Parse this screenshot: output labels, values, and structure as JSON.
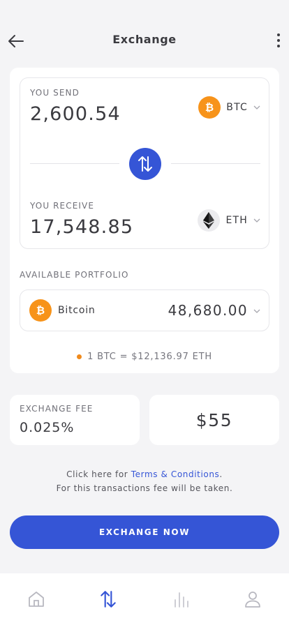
{
  "header": {
    "title": "Exchange"
  },
  "send": {
    "label": "YOU SEND",
    "amount": "2,600.54",
    "coin": "BTC"
  },
  "receive": {
    "label": "YOU RECEIVE",
    "amount": "17,548.85",
    "coin": "ETH"
  },
  "portfolio": {
    "label": "AVAILABLE PORTFOLIO",
    "coin_name": "Bitcoin",
    "value": "48,680.00"
  },
  "rate": {
    "text": "1 BTC = $12,136.97 ETH"
  },
  "fee": {
    "label": "EXCHANGE FEE",
    "value": "0.025%",
    "amount": "$55"
  },
  "terms": {
    "prefix": "Click here for ",
    "link": "Terms & Conditions",
    "suffix": ".",
    "line2": "For this transactions fee will be taken."
  },
  "cta": {
    "label": "EXCHANGE NOW"
  },
  "tabbar": {
    "icons": [
      "home-icon",
      "exchange-icon",
      "stats-icon",
      "profile-icon"
    ],
    "active": "exchange-icon"
  },
  "colors": {
    "accent": "#3555d6",
    "btc": "#f7931a",
    "rate_dot": "#f08a1c",
    "background": "#f4f4f6"
  }
}
